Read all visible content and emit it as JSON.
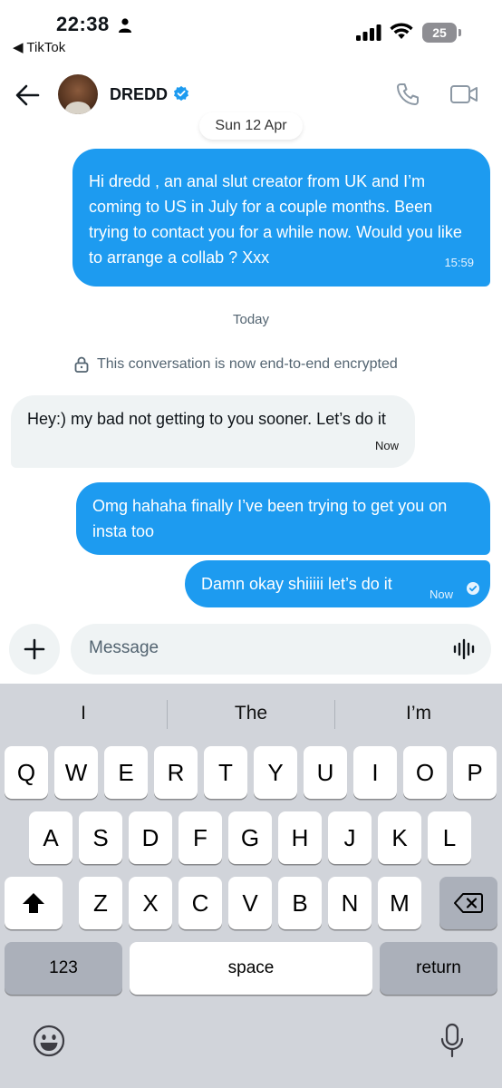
{
  "status_bar": {
    "time": "22:38",
    "back_app": "◀ TikTok",
    "battery": "25"
  },
  "header": {
    "name": "DREDD",
    "date_pill": "Sun 12 Apr"
  },
  "messages": [
    {
      "direction": "outgoing",
      "text": "Hi dredd , an anal slut creator from UK and I’m coming to US in July for a couple months. Been trying to contact you for a while now. Would you like to arrange a collab ? Xxx",
      "time": "15:59"
    },
    {
      "direction": "incoming",
      "text": "Hey:) my bad not getting to you sooner. Let’s do it",
      "time": "Now"
    },
    {
      "direction": "outgoing",
      "text": "Omg hahaha finally I’ve been trying to get you on insta too",
      "time": ""
    },
    {
      "direction": "outgoing",
      "text": "Damn okay shiiiii let’s do it",
      "time": "Now"
    }
  ],
  "divider_today": "Today",
  "encryption_notice": "This conversation is now end-to-end encrypted",
  "composer": {
    "placeholder": "Message"
  },
  "keyboard": {
    "suggestions": [
      "I",
      "The",
      "I’m"
    ],
    "row1": [
      "Q",
      "W",
      "E",
      "R",
      "T",
      "Y",
      "U",
      "I",
      "O",
      "P"
    ],
    "row2": [
      "A",
      "S",
      "D",
      "F",
      "G",
      "H",
      "J",
      "K",
      "L"
    ],
    "row3": [
      "Z",
      "X",
      "C",
      "V",
      "B",
      "N",
      "M"
    ],
    "numbers_key": "123",
    "space_key": "space",
    "return_key": "return"
  },
  "colors": {
    "accent": "#1d9bf0",
    "incoming_bubble": "#eff3f4",
    "keyboard_bg": "#d1d4da"
  },
  "icons": [
    "person-icon",
    "signal-icon",
    "wifi-icon",
    "battery-icon",
    "back-arrow-icon",
    "verified-badge-icon",
    "phone-icon",
    "video-icon",
    "lock-icon",
    "check-icon",
    "plus-icon",
    "voice-icon",
    "shift-icon",
    "delete-icon",
    "emoji-icon",
    "microphone-icon"
  ]
}
